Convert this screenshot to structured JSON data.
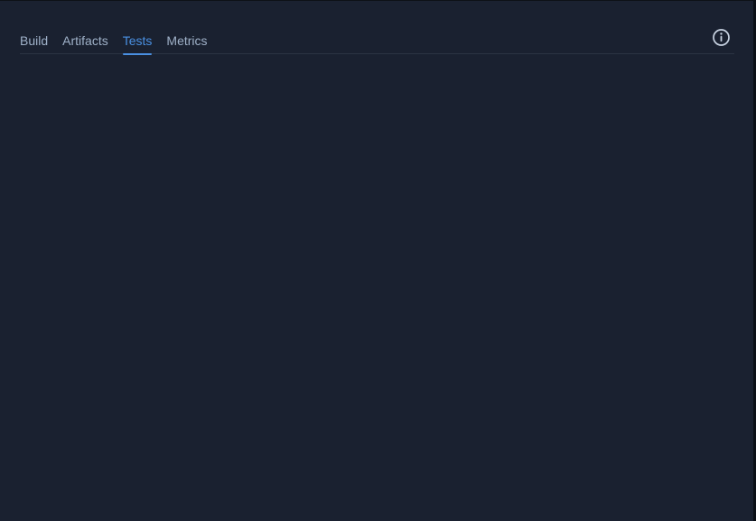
{
  "tabs": {
    "items": [
      {
        "label": "Build",
        "active": false
      },
      {
        "label": "Artifacts",
        "active": false
      },
      {
        "label": "Tests",
        "active": true
      },
      {
        "label": "Metrics",
        "active": false
      }
    ]
  },
  "toolbar": {
    "info_icon": "info-icon"
  },
  "colors": {
    "background": "#1a2130",
    "tab_text": "#9fb1c8",
    "accent": "#4a90e2",
    "divider": "#2b3442"
  }
}
